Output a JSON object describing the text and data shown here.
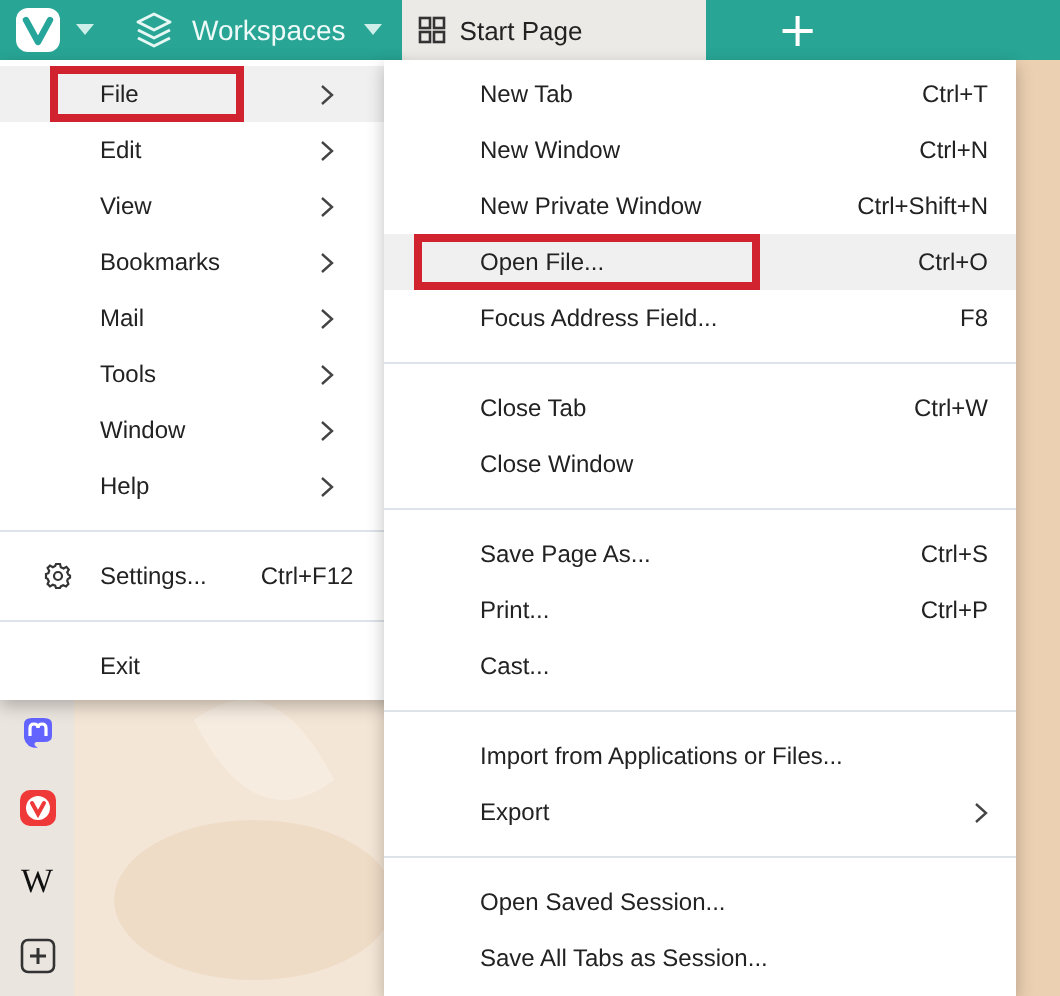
{
  "toolbar": {
    "workspaces": "Workspaces",
    "new_tab": "+"
  },
  "tabs": [
    {
      "label": "Start Page",
      "selected": true
    }
  ],
  "side_panel": [
    {
      "kind": "mastodon"
    },
    {
      "kind": "vivaldi"
    },
    {
      "kind": "text",
      "label": "W"
    },
    {
      "kind": "add"
    }
  ],
  "main_menu": [
    {
      "kind": "item",
      "label": "File",
      "arrow": true,
      "selected": true,
      "marked": true
    },
    {
      "kind": "item",
      "label": "Edit",
      "arrow": true,
      "selected": false,
      "marked": false
    },
    {
      "kind": "item",
      "label": "View",
      "arrow": true,
      "selected": false,
      "marked": false
    },
    {
      "kind": "item",
      "label": "Bookmarks",
      "arrow": true,
      "selected": false,
      "marked": false
    },
    {
      "kind": "item",
      "label": "Mail",
      "arrow": true,
      "selected": false,
      "marked": false
    },
    {
      "kind": "item",
      "label": "Tools",
      "arrow": true,
      "selected": false,
      "marked": false
    },
    {
      "kind": "item",
      "label": "Window",
      "arrow": true,
      "selected": false,
      "marked": false
    },
    {
      "kind": "item",
      "label": "Help",
      "arrow": true,
      "selected": false,
      "marked": false
    },
    {
      "kind": "separator"
    },
    {
      "kind": "settings",
      "label": "Settings...",
      "shortcut": "Ctrl+F12",
      "arrow": false,
      "selected": false,
      "marked": false
    },
    {
      "kind": "separator"
    },
    {
      "kind": "item",
      "label": "Exit",
      "arrow": false,
      "selected": false,
      "marked": false
    }
  ],
  "file_menu": [
    {
      "kind": "item",
      "label": "New Tab",
      "shortcut": "Ctrl+T",
      "arrow": false,
      "selected": false,
      "marked": false
    },
    {
      "kind": "item",
      "label": "New Window",
      "shortcut": "Ctrl+N",
      "arrow": false,
      "selected": false,
      "marked": false
    },
    {
      "kind": "item",
      "label": "New Private Window",
      "shortcut": "Ctrl+Shift+N",
      "arrow": false,
      "selected": false,
      "marked": false
    },
    {
      "kind": "item",
      "label": "Open File...",
      "shortcut": "Ctrl+O",
      "arrow": false,
      "selected": true,
      "marked": true
    },
    {
      "kind": "item",
      "label": "Focus Address Field...",
      "shortcut": "F8",
      "arrow": false,
      "selected": false,
      "marked": false
    },
    {
      "kind": "separator"
    },
    {
      "kind": "item",
      "label": "Close Tab",
      "shortcut": "Ctrl+W",
      "arrow": false,
      "selected": false,
      "marked": false
    },
    {
      "kind": "item",
      "label": "Close Window",
      "arrow": false,
      "selected": false,
      "marked": false
    },
    {
      "kind": "separator"
    },
    {
      "kind": "item",
      "label": "Save Page As...",
      "shortcut": "Ctrl+S",
      "arrow": false,
      "selected": false,
      "marked": false
    },
    {
      "kind": "item",
      "label": "Print...",
      "shortcut": "Ctrl+P",
      "arrow": false,
      "selected": false,
      "marked": false
    },
    {
      "kind": "item",
      "label": "Cast...",
      "arrow": false,
      "selected": false,
      "marked": false
    },
    {
      "kind": "separator"
    },
    {
      "kind": "item",
      "label": "Import from Applications or Files...",
      "arrow": false,
      "selected": false,
      "marked": false
    },
    {
      "kind": "item",
      "label": "Export",
      "arrow": true,
      "selected": false,
      "marked": false
    },
    {
      "kind": "separator"
    },
    {
      "kind": "item",
      "label": "Open Saved Session...",
      "arrow": false,
      "selected": false,
      "marked": false
    },
    {
      "kind": "item",
      "label": "Save All Tabs as Session...",
      "arrow": false,
      "selected": false,
      "marked": false
    }
  ]
}
